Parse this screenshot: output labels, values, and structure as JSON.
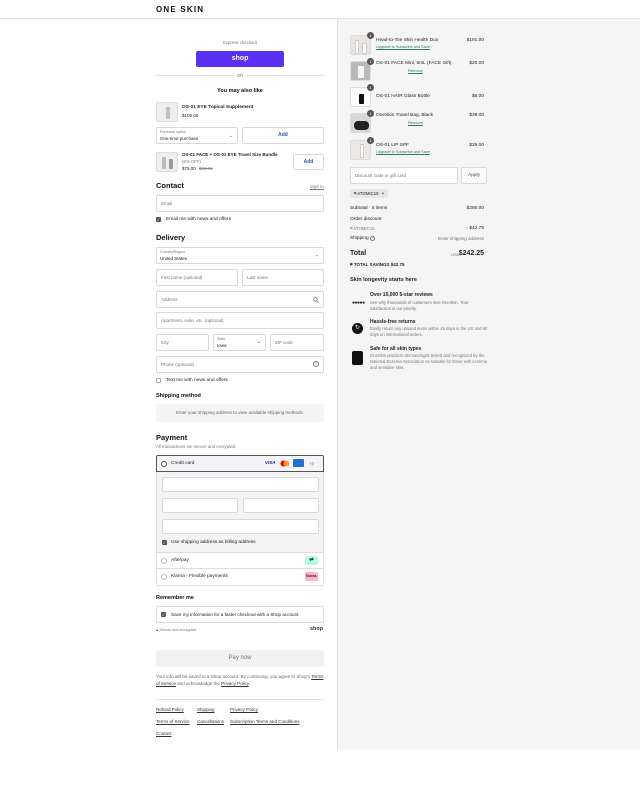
{
  "brand": "ONE SKIN",
  "express": {
    "label": "Express checkout",
    "shop_button": "shop",
    "or": "OR"
  },
  "upsell": {
    "title": "You may also like",
    "item1": {
      "name": "OS-01 EYE Topical Supplement",
      "price": "$109.00",
      "option_label": "Purchase option",
      "option_value": "One-time purchase",
      "add": "Add"
    },
    "item2": {
      "name": "OS-01 FACE + OS-01 EYE Travel Size Bundle",
      "discount": "(8% OFF)",
      "price": "$75.00",
      "old_price": "$82.00",
      "add": "Add"
    }
  },
  "contact": {
    "title": "Contact",
    "signin": "Sign in",
    "email_placeholder": "Email",
    "news": "Email me with news and offers"
  },
  "delivery": {
    "title": "Delivery",
    "country_label": "Country/Region",
    "country": "United States",
    "first_name": "First name (optional)",
    "last_name": "Last name",
    "address": "Address",
    "apartment": "Apartment, suite, etc. (optional)",
    "city": "City",
    "state_label": "State",
    "state": "Iowa",
    "zip": "ZIP code",
    "phone": "Phone (optional)",
    "text_news": "Text me with news and offers"
  },
  "shipping_method": {
    "title": "Shipping method",
    "message": "Enter your shipping address to view available shipping methods."
  },
  "payment": {
    "title": "Payment",
    "subtitle": "All transactions are secure and encrypted.",
    "credit_card": "Credit card",
    "more_cards": "+3",
    "billing": "Use shipping address as billing address",
    "afterpay": "Afterpay",
    "klarna": "Klarna - Flexible payments",
    "klarna_badge": "Klarna."
  },
  "remember": {
    "title": "Remember me",
    "save": "Save my information for a faster checkout with a Shop account",
    "secure": "Secure and encrypted",
    "shop": "shop"
  },
  "pay_now": "Pay now",
  "legal": {
    "text1": "Your info will be saved to a Shop account. By continuing, you agree to Shop's",
    "terms": "Terms of Service",
    "and": "and acknowledge the",
    "privacy": "Privacy Policy",
    "period": "."
  },
  "footer_links": [
    "Refund Policy",
    "Shipping",
    "Privacy Policy",
    "Terms of Service",
    "Cancellations",
    "Subscription Terms and Conditions",
    "Contact"
  ],
  "cart": {
    "items": [
      {
        "qty": "1",
        "name": "Head-to-Toe Skin Health Duo",
        "sub": "Upgrade to Subscribe and Save",
        "price": "$191.00"
      },
      {
        "qty": "1",
        "name": "OS-01 FACE Mini, 8mL (FACE Gift)",
        "sub": "Remove",
        "price": "$20.00"
      },
      {
        "qty": "1",
        "name": "OS-01 HAIR Glass Bottle",
        "sub": "",
        "price": "$6.00"
      },
      {
        "qty": "1",
        "name": "OneSkin Travel Bag, Black",
        "sub": "Remove",
        "price": "$39.00"
      },
      {
        "qty": "1",
        "name": "OS-01 LIP SPF",
        "sub": "Upgrade to Subscribe and Save",
        "price": "$29.00"
      }
    ],
    "discount_placeholder": "Discount code or gift card",
    "apply": "Apply",
    "code_tag": "ATOMIC15",
    "subtotal_label": "Subtotal · 5 items",
    "subtotal": "$285.00",
    "order_discount_label": "Order discount",
    "discount_code": "ATOMIC15",
    "discount_value": "- $42.75",
    "shipping_label": "Shipping",
    "shipping_value": "Enter shipping address",
    "total_label": "Total",
    "currency": "USD",
    "total": "$242.25",
    "savings_label": "TOTAL SAVINGS",
    "savings": "$42.75"
  },
  "longevity": {
    "title": "Skin longevity starts here",
    "features": [
      {
        "title": "Over 10,000 5-star reviews",
        "text": "See why thousands of customers love OneSkin. Your satisfaction is our priority."
      },
      {
        "title": "Hassle-free returns",
        "text": "Easily return any unused items within 45 days in the US and 60 days on international orders."
      },
      {
        "title": "Safe for all skin types",
        "text": "OneSkin products dermatologist tested and recognized by the National Eczema Association as suitable for those with eczema and sensitive skin."
      }
    ]
  },
  "colors": {
    "shop_purple": "#5a31f4",
    "afterpay_mint": "#b2fce4",
    "klarna_pink": "#ffb3c7"
  }
}
